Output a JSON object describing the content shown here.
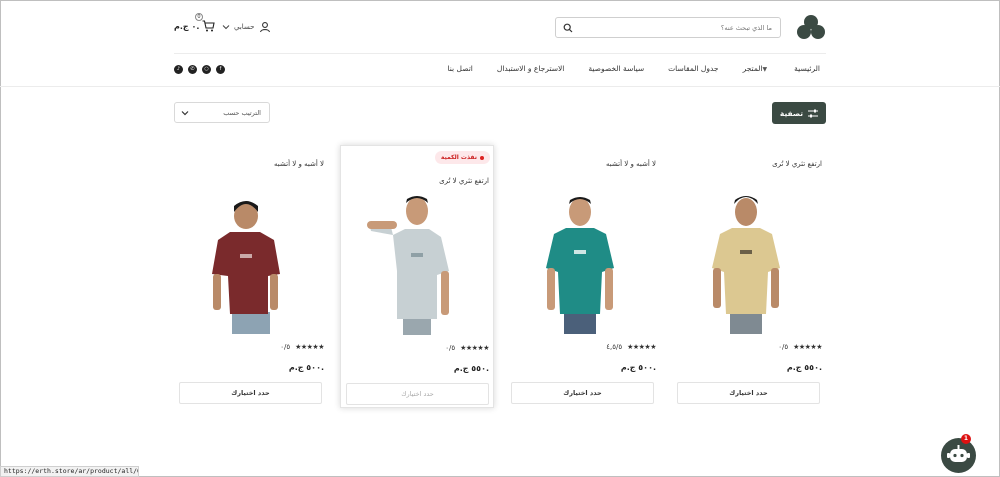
{
  "header": {
    "search": {
      "placeholder": "ما الذي تبحث عنه؟"
    },
    "account": {
      "label": "حسابي"
    },
    "cart": {
      "total": "٠ ج.م.",
      "count": "0"
    }
  },
  "nav": {
    "items": [
      {
        "label": "الرئيسية",
        "dropdown": false
      },
      {
        "label": "المتجر",
        "dropdown": true
      },
      {
        "label": "جدول المقاسات",
        "dropdown": false
      },
      {
        "label": "سياسة الخصوصية",
        "dropdown": false
      },
      {
        "label": "الاسترجاع و الاستبدال",
        "dropdown": false
      },
      {
        "label": "اتصل بنا",
        "dropdown": false
      }
    ],
    "socials": [
      "facebook-icon",
      "instagram-icon",
      "whatsapp-icon",
      "tiktok-icon"
    ]
  },
  "toolbar": {
    "filter_label": "تصفية",
    "sort_label": "الترتيب حسب"
  },
  "products": [
    {
      "title": "ارتفع تثري لا تُرى",
      "rating": "٠/٥",
      "price": "٥٥٠ ج.م.",
      "button": "حدد اختيارك",
      "sold_out": false,
      "shirt_color": "#dcc891"
    },
    {
      "title": "لا أشبه و لا أتشبه",
      "rating": "٤,٥/٥",
      "price": "٥٠٠ ج.م.",
      "button": "حدد اختيارك",
      "sold_out": false,
      "shirt_color": "#1f8c86"
    },
    {
      "title": "ارتفع تثري لا تُرى",
      "rating": "٠/٥",
      "price": "٥٥٠ ج.م.",
      "button": "حدد اختيارك",
      "sold_out": true,
      "badge": "نفذت الكمية",
      "shirt_color": "#c7d0d3"
    },
    {
      "title": "لا أشبه و لا أتشبه",
      "rating": "٠/٥",
      "price": "٥٠٠ ج.م.",
      "button": "حدد اختيارك",
      "sold_out": false,
      "shirt_color": "#7a2a2c"
    }
  ],
  "status_url": "https://erth.store/ar/product/all/0021",
  "chat": {
    "unread": "1"
  },
  "colors": {
    "accent": "#3b4a43",
    "sold_out": "#cc2222"
  }
}
